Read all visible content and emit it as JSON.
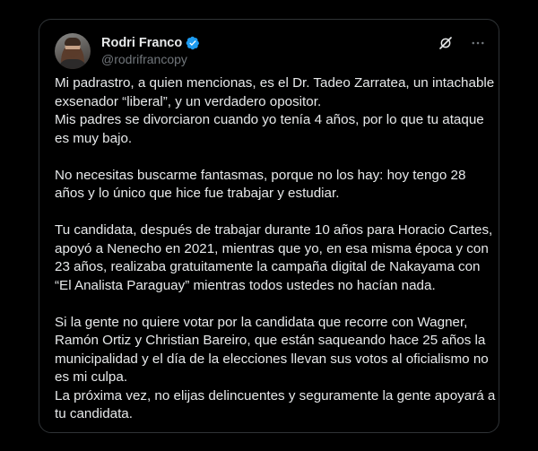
{
  "author": {
    "display_name": "Rodri Franco",
    "handle": "@rodrifrancopy",
    "avatar_icon": "profile-photo",
    "verified_icon": "verified-badge-icon"
  },
  "colors": {
    "background": "#000000",
    "text": "#e7e9ea",
    "muted": "#71767b",
    "verified": "#1d9bf0",
    "border": "#2f3336"
  },
  "actions": {
    "grok_icon": "grok-icon",
    "more_icon": "more-options-icon"
  },
  "body": {
    "paragraphs": [
      [
        "Mi padrastro, a quien mencionas, es el Dr. Tadeo Zarratea, un intachable",
        "exsenador “liberal”, y un verdadero opositor.",
        "Mis padres se divorciaron cuando yo tenía 4 años, por lo que tu ataque",
        "es muy bajo."
      ],
      [
        "No necesitas buscarme fantasmas, porque no los hay: hoy tengo 28",
        "años y lo único que hice fue trabajar y estudiar."
      ],
      [
        "Tu candidata, después de trabajar durante 10 años para Horacio Cartes,",
        "apoyó a Nenecho en 2021, mientras que yo, en esa misma época y con",
        "23 años, realizaba gratuitamente la campaña digital de Nakayama con",
        "“El Analista Paraguay” mientras todos ustedes no hacían nada."
      ],
      [
        "Si la gente no quiere votar por la candidata que recorre con Wagner,",
        "Ramón Ortiz y Christian Bareiro, que están saqueando hace 25 años la",
        "municipalidad y el día de la elecciones llevan sus votos al oficialismo no",
        "es mi culpa.",
        "La próxima vez, no elijas delincuentes y seguramente la gente apoyará a",
        "tu candidata."
      ]
    ]
  }
}
